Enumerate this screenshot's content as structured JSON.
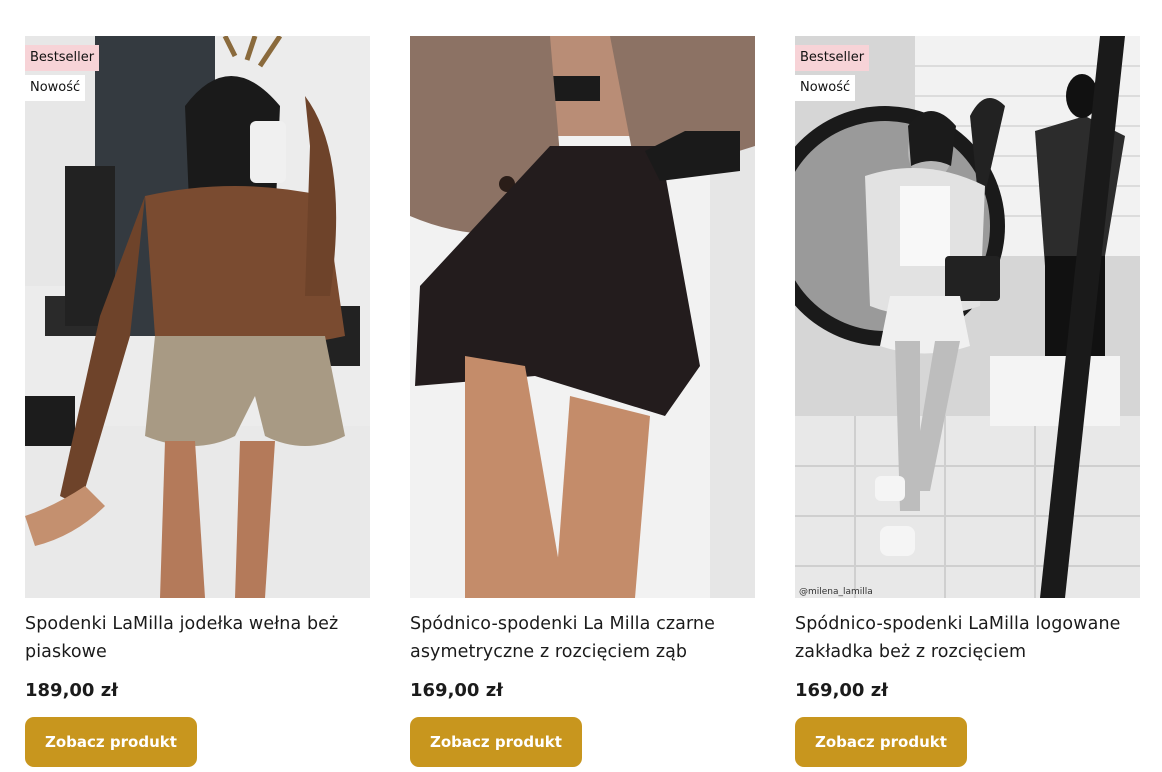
{
  "products": [
    {
      "badges": {
        "bestseller": "Bestseller",
        "new": "Nowość"
      },
      "title": "Spodenki LaMilla jodełka wełna beż piaskowe",
      "price": "189,00 zł",
      "button": "Zobacz produkt",
      "image_alt": "Spodenki LaMilla jodełka wełna beż piaskowe"
    },
    {
      "title": "Spódnico-spodenki La Milla czarne asymetryczne z rozcięciem ząb",
      "price": "169,00 zł",
      "button": "Zobacz produkt",
      "image_alt": "Spódnico-spodenki La Milla czarne asymetryczne z rozcięciem ząb"
    },
    {
      "badges": {
        "bestseller": "Bestseller",
        "new": "Nowość"
      },
      "title": "Spódnico-spodenki LaMilla logowane zakładka beż z rozcięciem",
      "price": "169,00 zł",
      "button": "Zobacz produkt",
      "image_alt": "Spódnico-spodenki LaMilla logowane zakładka beż z rozcięciem",
      "image_watermark": "@milena_lamilla"
    }
  ],
  "colors": {
    "button_bg": "#c8961e",
    "badge_bestseller_bg": "#f7d3d7",
    "badge_new_bg": "#ffffff"
  }
}
